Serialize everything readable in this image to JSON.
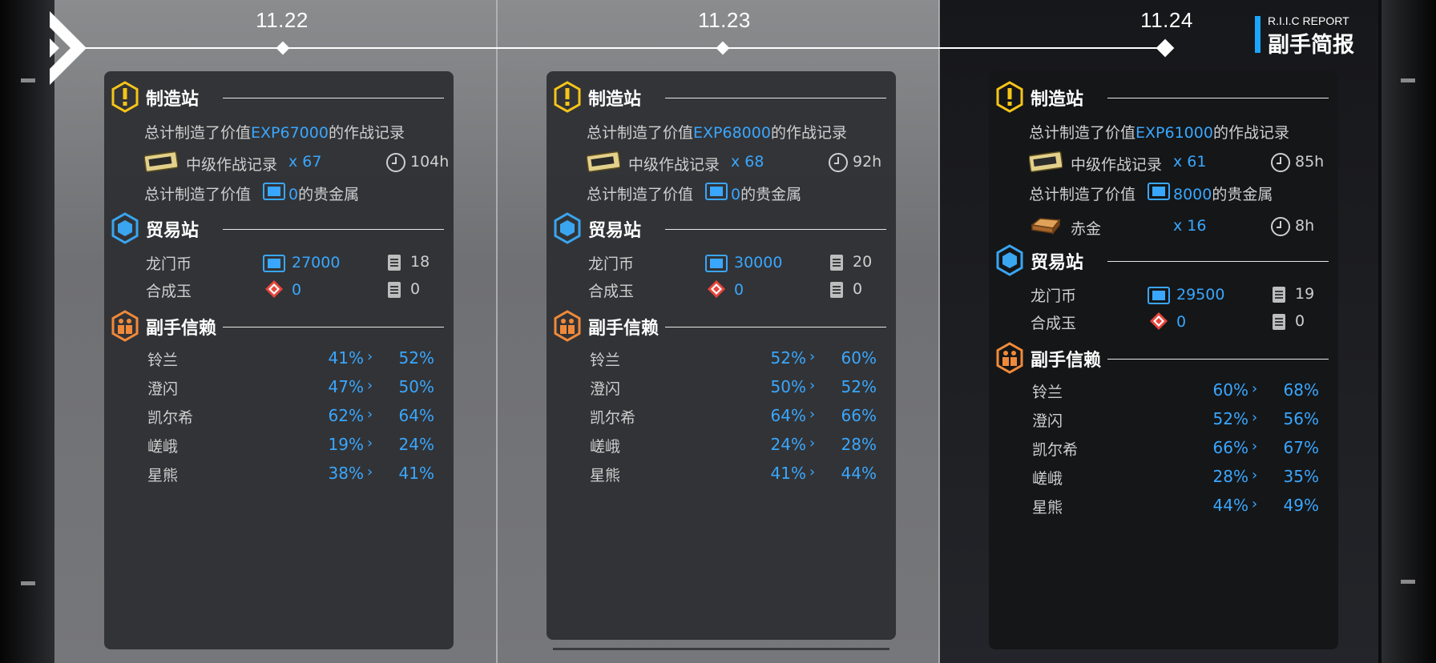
{
  "report": {
    "title_en": "R.I.I.C REPORT",
    "title_cn": "副手简报"
  },
  "colors": {
    "accent": "#39a7ff",
    "factory_icon": "#f5c518",
    "trade_icon": "#3aa5f0",
    "trust_icon": "#f08a3a"
  },
  "days": [
    {
      "date": "11.22",
      "factory": {
        "title": "制造站",
        "exp_prefix": "总计制造了价值",
        "exp_value": "EXP67000",
        "exp_suffix": "的作战记录",
        "item_name": "中级作战记录",
        "item_count": "x 67",
        "item_time": "104h",
        "gold_prefix": "总计制造了价值",
        "gold_value": "0",
        "gold_suffix": "的贵金属"
      },
      "trade": {
        "title": "贸易站",
        "rows": [
          {
            "name": "龙门币",
            "value": "27000",
            "orders": "18",
            "icon": "lmd-icon"
          },
          {
            "name": "合成玉",
            "value": "0",
            "orders": "0",
            "icon": "orundum-icon"
          }
        ]
      },
      "trust": {
        "title": "副手信赖",
        "rows": [
          {
            "name": "铃兰",
            "from": "41%",
            "to": "52%"
          },
          {
            "name": "澄闪",
            "from": "47%",
            "to": "50%"
          },
          {
            "name": "凯尔希",
            "from": "62%",
            "to": "64%"
          },
          {
            "name": "嵯峨",
            "from": "19%",
            "to": "24%"
          },
          {
            "name": "星熊",
            "from": "38%",
            "to": "41%"
          }
        ]
      }
    },
    {
      "date": "11.23",
      "factory": {
        "title": "制造站",
        "exp_prefix": "总计制造了价值",
        "exp_value": "EXP68000",
        "exp_suffix": "的作战记录",
        "item_name": "中级作战记录",
        "item_count": "x 68",
        "item_time": "92h",
        "gold_prefix": "总计制造了价值",
        "gold_value": "0",
        "gold_suffix": "的贵金属"
      },
      "trade": {
        "title": "贸易站",
        "rows": [
          {
            "name": "龙门币",
            "value": "30000",
            "orders": "20",
            "icon": "lmd-icon"
          },
          {
            "name": "合成玉",
            "value": "0",
            "orders": "0",
            "icon": "orundum-icon"
          }
        ]
      },
      "trust": {
        "title": "副手信赖",
        "rows": [
          {
            "name": "铃兰",
            "from": "52%",
            "to": "60%"
          },
          {
            "name": "澄闪",
            "from": "50%",
            "to": "52%"
          },
          {
            "name": "凯尔希",
            "from": "64%",
            "to": "66%"
          },
          {
            "name": "嵯峨",
            "from": "24%",
            "to": "28%"
          },
          {
            "name": "星熊",
            "from": "41%",
            "to": "44%"
          }
        ]
      }
    },
    {
      "date": "11.24",
      "factory": {
        "title": "制造站",
        "exp_prefix": "总计制造了价值",
        "exp_value": "EXP61000",
        "exp_suffix": "的作战记录",
        "item_name": "中级作战记录",
        "item_count": "x 61",
        "item_time": "85h",
        "gold_prefix": "总计制造了价值",
        "gold_value": "8000",
        "gold_suffix": "的贵金属",
        "gold_item_name": "赤金",
        "gold_item_count": "x 16",
        "gold_item_time": "8h"
      },
      "trade": {
        "title": "贸易站",
        "rows": [
          {
            "name": "龙门币",
            "value": "29500",
            "orders": "19",
            "icon": "lmd-icon"
          },
          {
            "name": "合成玉",
            "value": "0",
            "orders": "0",
            "icon": "orundum-icon"
          }
        ]
      },
      "trust": {
        "title": "副手信赖",
        "rows": [
          {
            "name": "铃兰",
            "from": "60%",
            "to": "68%"
          },
          {
            "name": "澄闪",
            "from": "52%",
            "to": "56%"
          },
          {
            "name": "凯尔希",
            "from": "66%",
            "to": "67%"
          },
          {
            "name": "嵯峨",
            "from": "28%",
            "to": "35%"
          },
          {
            "name": "星熊",
            "from": "44%",
            "to": "49%"
          }
        ]
      }
    }
  ]
}
